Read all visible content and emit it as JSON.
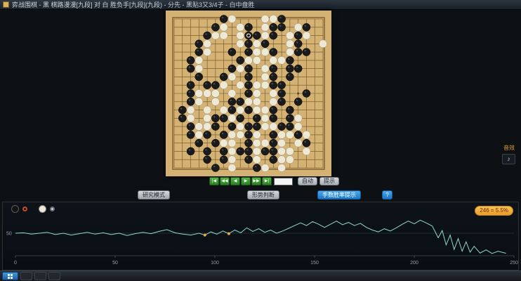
{
  "window": {
    "title": "弈战围棋 - 黑 棋路漫漫[九段] 对 白 胜负手[九段](九段) - 分先 - 黑贴3又3/4子 - 白中盘胜",
    "app_icon": "go-board-icon"
  },
  "board": {
    "wood_color": "#d3b273",
    "line_color": "#6e4f22",
    "last_move": {
      "col": 9,
      "row": 2
    },
    "rows": [
      "......BW...WWB.....",
      ".....BW.WB.WBB.WB..",
      "....BWW.WBBWB.WBW..",
      "...BW...WBWB..WB..W",
      "...BW..B.BWWB.WBB..",
      "..BW....BWW.WWB....",
      "..BW...BWB.WB.BB...",
      "...B..BW.B.WB.B....",
      "..B.BBW.WBWWBB.....",
      "..BWWW.W.BW.WB..B..",
      "..BW.W.BBWW.WB.B...",
      ".BW.W.WBWBWWB.B....",
      ".BW.WBBWB.BWB.BW...",
      "..BWWB.BWBBWWBBW...",
      "..BWB.BWWBW.BWWBW..",
      "...B.BWW.BWWBW.WB..",
      "..B.B.BWBBWBBWW.W..",
      "....B.BW.BW.BWW....",
      ".....B.W..BW.W....."
    ]
  },
  "controls": {
    "playback": [
      {
        "name": "first-move",
        "glyph": "|◀"
      },
      {
        "name": "back-10",
        "glyph": "◀◀"
      },
      {
        "name": "back-1",
        "glyph": "◀"
      },
      {
        "name": "forward-1",
        "glyph": "▶"
      },
      {
        "name": "forward-10",
        "glyph": "▶▶"
      },
      {
        "name": "last-move",
        "glyph": "▶|"
      }
    ],
    "move_input_value": "",
    "auto_label": "自动",
    "hint_label": "提示",
    "research_label": "研究模式",
    "judge_label": "形势判断",
    "winrate_toggle_label": "手数胜率提示",
    "help_label": "?"
  },
  "side_panel": {
    "sound_label": "音效",
    "sound_icon": "speaker-icon",
    "sound_glyph": "♪"
  },
  "chart_data": {
    "type": "line",
    "title": "",
    "xlabel": "",
    "ylabel": "",
    "xlim": [
      0,
      250
    ],
    "ylim": [
      0,
      100
    ],
    "xticks": [
      0,
      50,
      100,
      150,
      200,
      250
    ],
    "yticks": [
      50
    ],
    "grid": "50%-line only",
    "legend_position": "top-left",
    "line_color": "#8fd8cc",
    "marker_color": "#f0a43c",
    "tooltip": "246 = 5.5%",
    "series": [
      {
        "name": "black-win-rate-percent",
        "points": [
          [
            0,
            50
          ],
          [
            4,
            51
          ],
          [
            8,
            48
          ],
          [
            12,
            50
          ],
          [
            16,
            52
          ],
          [
            20,
            47
          ],
          [
            24,
            50
          ],
          [
            28,
            46
          ],
          [
            32,
            49
          ],
          [
            36,
            52
          ],
          [
            40,
            48
          ],
          [
            44,
            51
          ],
          [
            48,
            47
          ],
          [
            52,
            50
          ],
          [
            56,
            45
          ],
          [
            60,
            49
          ],
          [
            64,
            52
          ],
          [
            68,
            49
          ],
          [
            72,
            54
          ],
          [
            76,
            58
          ],
          [
            80,
            51
          ],
          [
            84,
            48
          ],
          [
            88,
            46
          ],
          [
            92,
            50
          ],
          [
            95,
            46
          ],
          [
            98,
            53
          ],
          [
            101,
            48
          ],
          [
            104,
            55
          ],
          [
            107,
            49
          ],
          [
            110,
            57
          ],
          [
            113,
            51
          ],
          [
            116,
            62
          ],
          [
            119,
            54
          ],
          [
            122,
            60
          ],
          [
            125,
            52
          ],
          [
            128,
            57
          ],
          [
            131,
            50
          ],
          [
            134,
            55
          ],
          [
            137,
            61
          ],
          [
            140,
            67
          ],
          [
            143,
            73
          ],
          [
            146,
            67
          ],
          [
            149,
            76
          ],
          [
            152,
            70
          ],
          [
            155,
            63
          ],
          [
            158,
            70
          ],
          [
            161,
            77
          ],
          [
            164,
            69
          ],
          [
            167,
            74
          ],
          [
            170,
            67
          ],
          [
            173,
            72
          ],
          [
            176,
            63
          ],
          [
            179,
            57
          ],
          [
            182,
            53
          ],
          [
            185,
            60
          ],
          [
            188,
            55
          ],
          [
            191,
            62
          ],
          [
            194,
            70
          ],
          [
            197,
            77
          ],
          [
            200,
            71
          ],
          [
            203,
            79
          ],
          [
            206,
            73
          ],
          [
            209,
            66
          ],
          [
            212,
            40
          ],
          [
            214,
            56
          ],
          [
            216,
            24
          ],
          [
            218,
            46
          ],
          [
            220,
            14
          ],
          [
            222,
            38
          ],
          [
            224,
            10
          ],
          [
            226,
            31
          ],
          [
            228,
            8
          ],
          [
            230,
            21
          ],
          [
            233,
            6
          ],
          [
            236,
            13
          ],
          [
            239,
            5
          ],
          [
            242,
            10
          ],
          [
            246,
            5.5
          ]
        ]
      }
    ],
    "markers": [
      [
        95,
        46
      ],
      [
        107,
        49
      ]
    ]
  },
  "taskbar": {
    "apps": [
      "app-1",
      "app-2",
      "app-3"
    ]
  }
}
